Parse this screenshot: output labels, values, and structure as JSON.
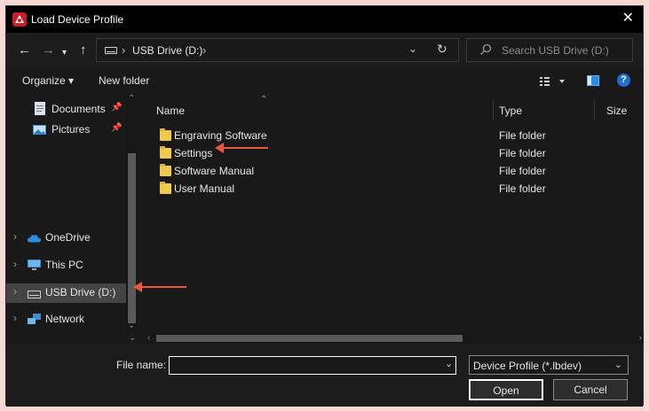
{
  "window": {
    "title": "Load Device Profile",
    "close_glyph": "✕",
    "app_icon": "app-logo-icon"
  },
  "address": {
    "crumb_separator": "›",
    "crumbs": [
      "USB Drive (D:)"
    ],
    "search_placeholder": "Search USB Drive (D:)"
  },
  "toolbar": {
    "organize": "Organize ▾",
    "new_folder": "New folder",
    "help": "?"
  },
  "nav": {
    "items": [
      {
        "label": "Documents",
        "pinned": true
      },
      {
        "label": "Pictures",
        "pinned": true
      },
      {
        "label": "OneDrive",
        "expandable": true
      },
      {
        "label": "This PC",
        "expandable": true
      },
      {
        "label": "USB Drive (D:)",
        "expandable": true,
        "selected": true
      },
      {
        "label": "Network",
        "expandable": true
      }
    ]
  },
  "files": {
    "columns": {
      "name": "Name",
      "type": "Type",
      "size": "Size"
    },
    "rows": [
      {
        "name": "Engraving Software",
        "type": "File folder"
      },
      {
        "name": "Settings",
        "type": "File folder"
      },
      {
        "name": "Software Manual",
        "type": "File folder"
      },
      {
        "name": "User Manual",
        "type": "File folder"
      }
    ]
  },
  "bottom": {
    "file_name_label": "File name:",
    "file_name_value": "",
    "filter_value": "Device Profile (*.lbdev)",
    "open_label": "Open",
    "cancel_label": "Cancel"
  },
  "colors": {
    "background": "#191919",
    "annotation_arrow": "#e8573a",
    "folder": "#f0c94d",
    "accent": "#1f6fd1"
  }
}
